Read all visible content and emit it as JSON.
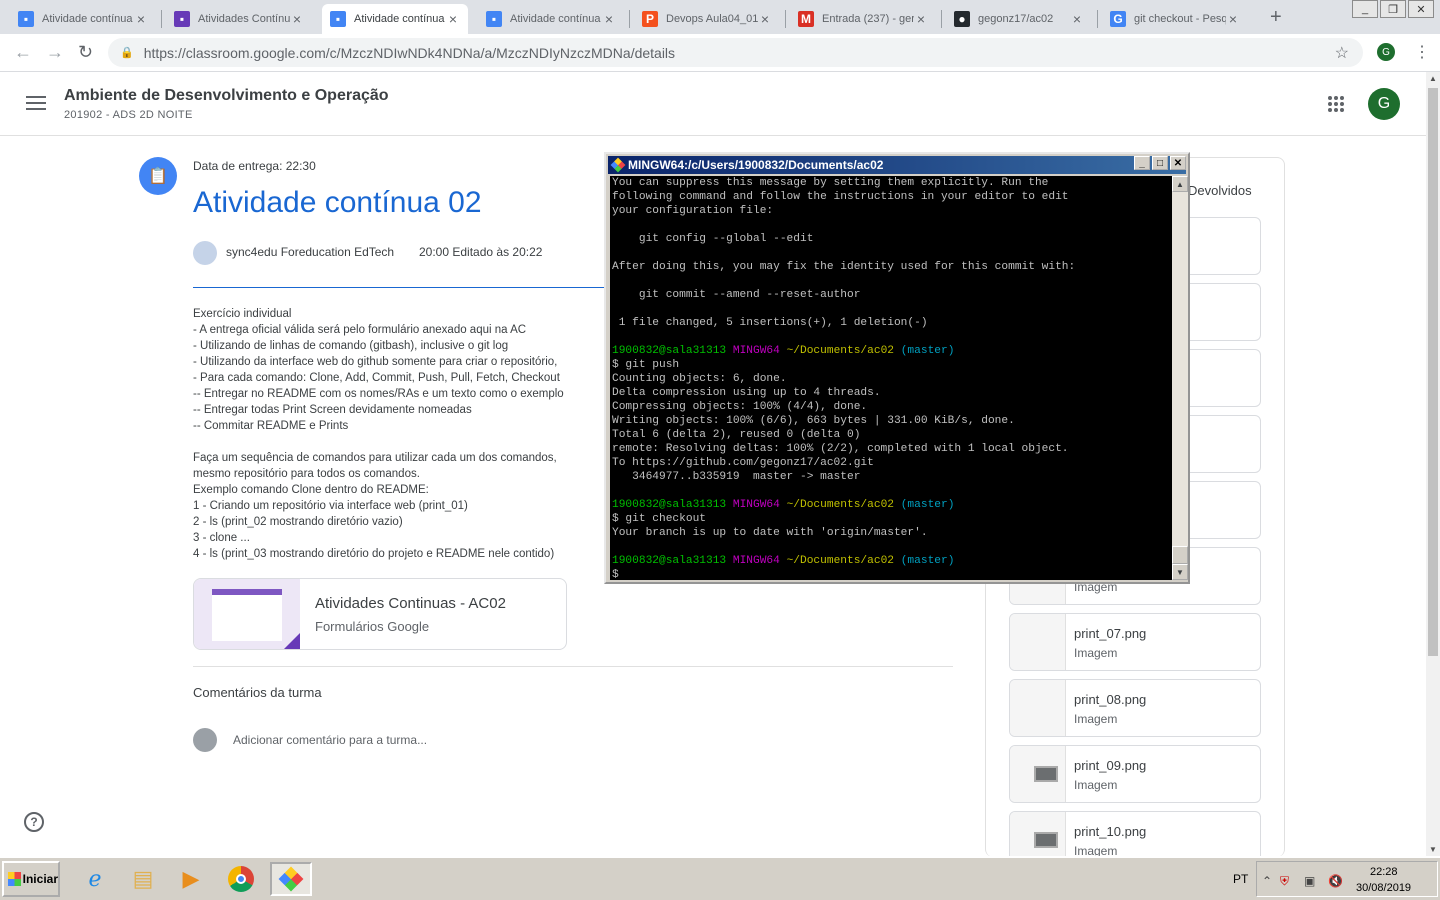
{
  "browser": {
    "tabs": [
      {
        "title": "Atividade contínua",
        "icon": "classroom-icon",
        "color": "#4285f4"
      },
      {
        "title": "Atividades Contínu",
        "icon": "forms-icon",
        "color": "#673ab7"
      },
      {
        "title": "Atividade contínua",
        "icon": "classroom-icon",
        "color": "#4285f4"
      },
      {
        "title": "Atividade contínua",
        "icon": "classroom-icon",
        "color": "#4285f4"
      },
      {
        "title": "Devops Aula04_01",
        "icon": "pdf-icon",
        "color": "#f4511e"
      },
      {
        "title": "Entrada (237) - ger",
        "icon": "gmail-icon",
        "color": "#d93025"
      },
      {
        "title": "gegonz17/ac02",
        "icon": "github-icon",
        "color": "#24292e"
      },
      {
        "title": "git checkout - Pesq",
        "icon": "google-icon",
        "color": "#4285f4"
      }
    ],
    "url": "https://classroom.google.com/c/MzczNDIwNDk4NDNa/a/MzczNDIyNzczMDNa/details",
    "profile_initial": "G"
  },
  "classroom": {
    "course_title": "Ambiente de Desenvolvimento e Operação",
    "course_subtitle": "201902 - ADS 2D NOITE",
    "avatar_initial": "G",
    "due": "Data de entrega: 22:30",
    "title": "Atividade contínua 02",
    "author": "sync4edu Foreducation EdTech",
    "edited": "20:00 Editado às 20:22",
    "description": [
      "Exercício individual",
      "- A entrega oficial válida será pelo formulário anexado aqui na AC",
      "- Utilizando de linhas de comando (gitbash), inclusive o git log",
      "- Utilizando da interface web do github somente para criar o repositório,",
      "- Para cada comando: Clone, Add, Commit, Push, Pull, Fetch, Checkout",
      "-- Entregar no README com os nomes/RAs e um texto como o exemplo",
      "-- Entregar todas Print Screen devidamente nomeadas",
      "-- Commitar README e Prints",
      "",
      "Faça um sequência de comandos para utilizar cada um dos comandos,",
      "mesmo repositório para todos os comandos.",
      "Exemplo comando Clone dentro do README:",
      "1 - Criando um repositório via interface web (print_01)",
      "2 - ls (print_02 mostrando diretório vazio)",
      "3 - clone ...",
      "4 - ls (print_03 mostrando diretório do projeto e README nele contido)"
    ],
    "form_card": {
      "title": "Atividades Continuas - AC02",
      "subtitle": "Formulários Google"
    },
    "comments_heading": "Comentários da turma",
    "comment_placeholder": "Adicionar comentário para a turma...",
    "right_heading": "Devolvidos",
    "attachments": [
      {
        "name": "",
        "kind": ""
      },
      {
        "name": "",
        "kind": ""
      },
      {
        "name": "",
        "kind": ""
      },
      {
        "name": "",
        "kind": ""
      },
      {
        "name": "",
        "kind": ""
      },
      {
        "name": "",
        "kind": "Imagem"
      },
      {
        "name": "print_07.png",
        "kind": "Imagem"
      },
      {
        "name": "print_08.png",
        "kind": "Imagem"
      },
      {
        "name": "print_09.png",
        "kind": "Imagem"
      },
      {
        "name": "print_10.png",
        "kind": "Imagem"
      }
    ]
  },
  "terminal": {
    "title": "MINGW64:/c/Users/1900832/Documents/ac02",
    "lines": [
      {
        "t": "You can suppress this message by setting them explicitly. Run the"
      },
      {
        "t": "following command and follow the instructions in your editor to edit"
      },
      {
        "t": "your configuration file:"
      },
      {
        "t": ""
      },
      {
        "t": "    git config --global --edit"
      },
      {
        "t": ""
      },
      {
        "t": "After doing this, you may fix the identity used for this commit with:"
      },
      {
        "t": ""
      },
      {
        "t": "    git commit --amend --reset-author"
      },
      {
        "t": ""
      },
      {
        "t": " 1 file changed, 5 insertions(+), 1 deletion(-)"
      },
      {
        "t": ""
      },
      {
        "prompt": true,
        "user": "1900832@sala31313",
        "sys": "MINGW64",
        "path": "~/Documents/ac02",
        "branch": "(master)"
      },
      {
        "t": "$ git push"
      },
      {
        "t": "Counting objects: 6, done."
      },
      {
        "t": "Delta compression using up to 4 threads."
      },
      {
        "t": "Compressing objects: 100% (4/4), done."
      },
      {
        "t": "Writing objects: 100% (6/6), 663 bytes | 331.00 KiB/s, done."
      },
      {
        "t": "Total 6 (delta 2), reused 0 (delta 0)"
      },
      {
        "t": "remote: Resolving deltas: 100% (2/2), completed with 1 local object."
      },
      {
        "t": "To https://github.com/gegonz17/ac02.git"
      },
      {
        "t": "   3464977..b335919  master -> master"
      },
      {
        "t": ""
      },
      {
        "prompt": true,
        "user": "1900832@sala31313",
        "sys": "MINGW64",
        "path": "~/Documents/ac02",
        "branch": "(master)"
      },
      {
        "t": "$ git checkout"
      },
      {
        "t": "Your branch is up to date with 'origin/master'."
      },
      {
        "t": ""
      },
      {
        "prompt": true,
        "user": "1900832@sala31313",
        "sys": "MINGW64",
        "path": "~/Documents/ac02",
        "branch": "(master)"
      },
      {
        "t": "$"
      }
    ]
  },
  "taskbar": {
    "start_label": "Iniciar",
    "apps": [
      "internet-explorer-icon",
      "file-explorer-icon",
      "media-player-icon",
      "chrome-icon",
      "git-bash-icon"
    ],
    "language": "PT",
    "time": "22:28",
    "date": "30/08/2019"
  }
}
